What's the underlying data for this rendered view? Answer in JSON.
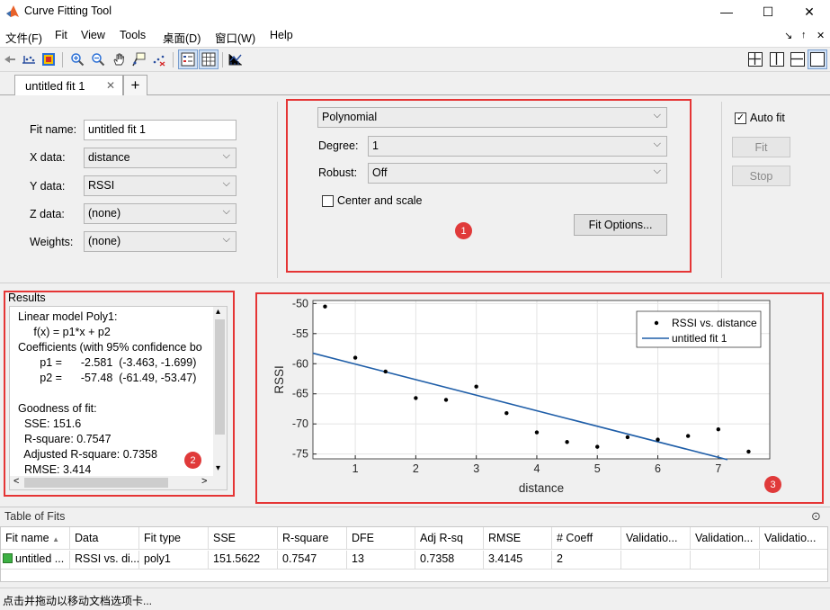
{
  "window": {
    "title": "Curve Fitting Tool",
    "minimize": "—",
    "maximize": "☐",
    "close": "✕"
  },
  "menu": [
    {
      "label": "文件(F)"
    },
    {
      "label": "Fit"
    },
    {
      "label": "View"
    },
    {
      "label": "Tools"
    },
    {
      "label": "桌面(D)"
    },
    {
      "label": "窗口(W)"
    },
    {
      "label": "Help"
    }
  ],
  "menu_right": {
    "undock": "↘",
    "collapse": "↑",
    "close": "✕"
  },
  "toolbar": {
    "icons": [
      "back-arrow-icon",
      "data-cursor-icon",
      "color-map-icon",
      "zoom-in-icon",
      "zoom-out-icon",
      "pan-hand-icon",
      "data-tip-icon",
      "exclude-outliers-icon",
      "legend-toggle-icon",
      "grid-toggle-icon",
      "residuals-plot-icon"
    ],
    "layout_icons": [
      "layout-grid-icon",
      "layout-vertical-icon",
      "layout-horizontal-icon",
      "layout-single-icon"
    ]
  },
  "tabs": {
    "fit_tab": "untitled fit 1",
    "close": "✕",
    "add": "+"
  },
  "fit_setup": {
    "fit_name_label": "Fit name:",
    "fit_name_value": "untitled fit 1",
    "x_data_label": "X data:",
    "x_data_value": "distance",
    "y_data_label": "Y data:",
    "y_data_value": "RSSI",
    "z_data_label": "Z data:",
    "z_data_value": "(none)",
    "weights_label": "Weights:",
    "weights_value": "(none)"
  },
  "fit_options": {
    "fit_type": "Polynomial",
    "degree_label": "Degree:",
    "degree_value": "1",
    "robust_label": "Robust:",
    "robust_value": "Off",
    "center_scale_label": "Center and scale",
    "center_scale_checked": false,
    "fit_options_button": "Fit Options...",
    "badge": "1"
  },
  "auto_fit": {
    "label": "Auto fit",
    "checked": true,
    "check_mark": "✓",
    "fit_button": "Fit",
    "stop_button": "Stop"
  },
  "results": {
    "header": "Results",
    "badge": "2",
    "lines": [
      "Linear model Poly1:",
      "     f(x) = p1*x + p2",
      "Coefficients (with 95% confidence bo",
      "       p1 =      -2.581  (-3.463, -1.699)",
      "       p2 =      -57.48  (-61.49, -53.47)",
      "",
      "Goodness of fit:",
      "  SSE: 151.6",
      "  R-square: 0.7547",
      "  Adjusted R-square: 0.7358",
      "  RMSE: 3.414"
    ],
    "scroll_up": "▴",
    "scroll_down": "▾",
    "scroll_left": "<",
    "scroll_right": ">"
  },
  "plot_badge": "3",
  "chart_data": {
    "type": "scatter",
    "title": "",
    "xlabel": "distance",
    "ylabel": "RSSI",
    "xlim": [
      0.3,
      7.85
    ],
    "ylim": [
      -75.8,
      -49.5
    ],
    "xticks": [
      1,
      2,
      3,
      4,
      5,
      6,
      7
    ],
    "yticks": [
      -50,
      -55,
      -60,
      -65,
      -70,
      -75
    ],
    "grid": true,
    "legend": {
      "placement": "top-right",
      "entries": [
        "RSSI vs. distance",
        "untitled fit 1"
      ]
    },
    "series": [
      {
        "name": "RSSI vs. distance",
        "kind": "points",
        "color": "#000000",
        "x": [
          0.5,
          1.0,
          1.5,
          2.0,
          2.5,
          3.0,
          3.5,
          4.0,
          4.5,
          5.0,
          5.5,
          6.0,
          6.5,
          7.0,
          7.5
        ],
        "y": [
          -50.5,
          -59.0,
          -61.3,
          -65.7,
          -66.0,
          -63.8,
          -68.2,
          -71.4,
          -73.0,
          -73.8,
          -72.2,
          -72.6,
          -72.0,
          -70.9,
          -74.6
        ]
      },
      {
        "name": "untitled fit 1",
        "kind": "line",
        "color": "#1f5ea8",
        "p1": -2.581,
        "p2": -57.48,
        "x": [
          0.3,
          7.15
        ]
      }
    ]
  },
  "table_of_fits": {
    "header": "Table of Fits",
    "toggle": "⊙",
    "sort_indicator": "▲",
    "columns": [
      "Fit name",
      "Data",
      "Fit type",
      "SSE",
      "R-square",
      "DFE",
      "Adj R-sq",
      "RMSE",
      "# Coeff",
      "Validatio...",
      "Validation...",
      "Validatio..."
    ],
    "rows": [
      [
        "untitled ...",
        "RSSI vs. di...",
        "poly1",
        "151.5622",
        "0.7547",
        "13",
        "0.7358",
        "3.4145",
        "2",
        "",
        "",
        ""
      ]
    ],
    "status_color": "#3cb043"
  },
  "statusbar": {
    "text": "点击并拖动以移动文档选项卡..."
  }
}
